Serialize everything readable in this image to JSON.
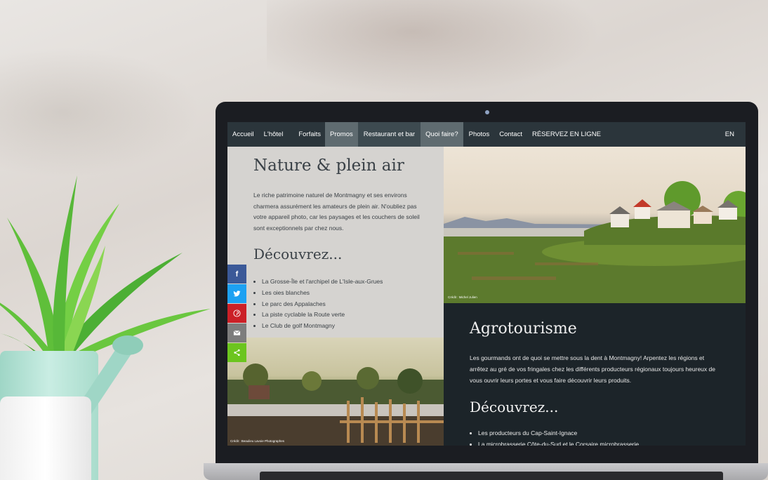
{
  "nav": {
    "items": [
      "Accueil",
      "L'hôtel",
      "Forfaits",
      "Promos",
      "Restaurant et bar",
      "Quoi faire?",
      "Photos",
      "Contact",
      "RÉSERVEZ EN LIGNE"
    ],
    "lang": "EN"
  },
  "nature": {
    "title": "Nature & plein air",
    "text": "Le riche patrimoine naturel de Montmagny et ses environs charmera assurément les amateurs de plein air. N'oubliez pas votre appareil photo, car les paysages et les couchers de soleil sont exceptionnels par chez nous.",
    "discover_title": "Découvrez...",
    "list": [
      "La Grosse-Île et l'archipel de L'Isle-aux-Grues",
      "Les oies blanches",
      "Le parc des Appalaches",
      "La piste cyclable la Route verte",
      "Le Club de golf Montmagny"
    ]
  },
  "agro": {
    "title": "Agrotourisme",
    "text": "Les gourmands ont de quoi se mettre sous la dent à Montmagny! Arpentez les régions et arrêtez au gré de vos fringales chez les différents producteurs régionaux toujours heureux de vous ouvrir leurs portes et vous faire découvrir leurs produits.",
    "discover_title": "Découvrez...",
    "list": [
      "Les producteurs du Cap-Saint-Ignace",
      "La microbrasserie Côte-du-Sud et le Corsaire microbrasserie"
    ]
  },
  "credits": {
    "right_image": "Crédit : Michel Julien",
    "left_image": "Crédit : Beaulieu Lavoie Photographes"
  },
  "share": {
    "icons": [
      "facebook-icon",
      "twitter-icon",
      "pinterest-icon",
      "email-icon",
      "share-icon"
    ],
    "colors": [
      "#3b5998",
      "#1da1f2",
      "#cb2027",
      "#7d7d7d",
      "#6cc51f"
    ]
  }
}
